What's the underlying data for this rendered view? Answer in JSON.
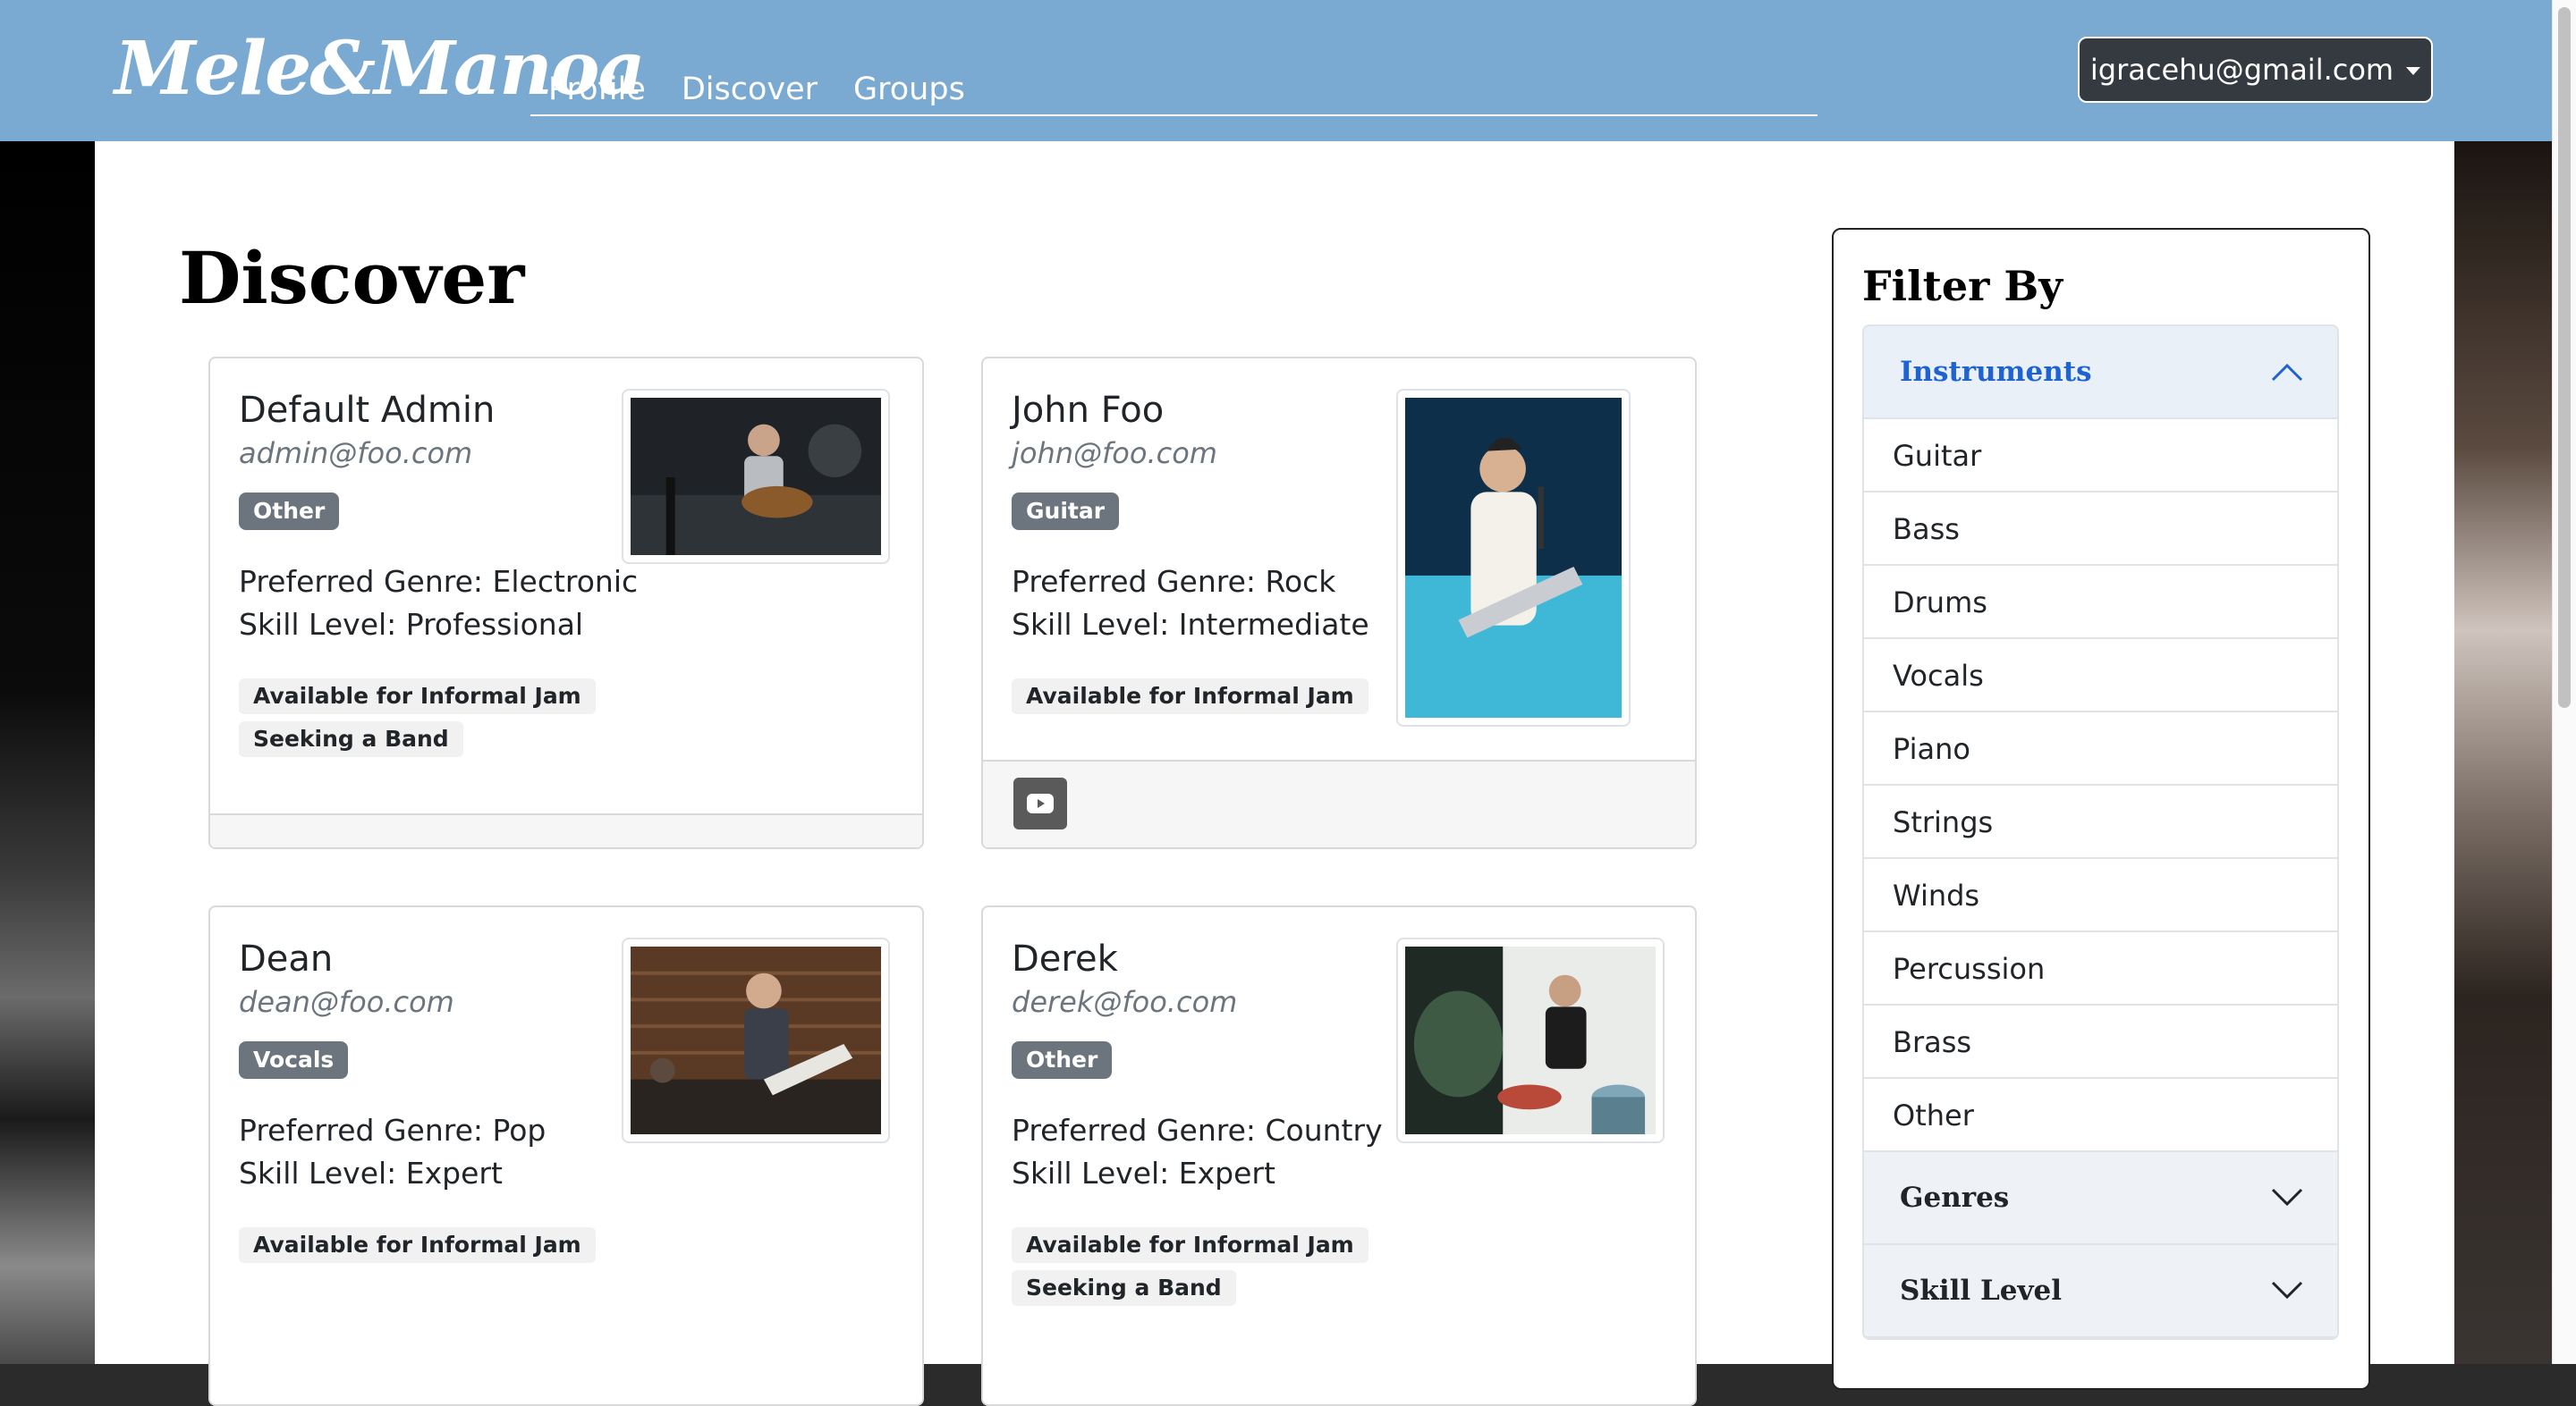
{
  "brand": {
    "name": "Mele&Manoa"
  },
  "nav": {
    "links": [
      "Profile",
      "Discover",
      "Groups"
    ]
  },
  "user": {
    "email": "igracehu@gmail.com"
  },
  "page": {
    "title": "Discover"
  },
  "cards": [
    {
      "name": "Default Admin",
      "email": "admin@foo.com",
      "instrument": "Other",
      "genre": "Preferred Genre: Electronic",
      "skill": "Skill Level: Professional",
      "tags": [
        "Available for Informal Jam",
        "Seeking a Band"
      ]
    },
    {
      "name": "John Foo",
      "email": "john@foo.com",
      "instrument": "Guitar",
      "genre": "Preferred Genre: Rock",
      "skill": "Skill Level: Intermediate",
      "tags": [
        "Available for Informal Jam"
      ],
      "links": [
        "youtube-icon"
      ]
    },
    {
      "name": "Dean",
      "email": "dean@foo.com",
      "instrument": "Vocals",
      "genre": "Preferred Genre: Pop",
      "skill": "Skill Level: Expert",
      "tags": [
        "Available for Informal Jam"
      ]
    },
    {
      "name": "Derek",
      "email": "derek@foo.com",
      "instrument": "Other",
      "genre": "Preferred Genre: Country",
      "skill": "Skill Level: Expert",
      "tags": [
        "Available for Informal Jam",
        "Seeking a Band"
      ]
    }
  ],
  "filter": {
    "title": "Filter By",
    "sections": [
      {
        "label": "Instruments",
        "expanded": true,
        "items": [
          "Guitar",
          "Bass",
          "Drums",
          "Vocals",
          "Piano",
          "Strings",
          "Winds",
          "Percussion",
          "Brass",
          "Other"
        ]
      },
      {
        "label": "Genres",
        "expanded": false
      },
      {
        "label": "Skill Level",
        "expanded": false
      }
    ]
  },
  "colors": {
    "navbar": "#7aaad1",
    "user_button": "#343a40",
    "badge": "#6c757d",
    "accordion_active": "#1f63d1"
  }
}
